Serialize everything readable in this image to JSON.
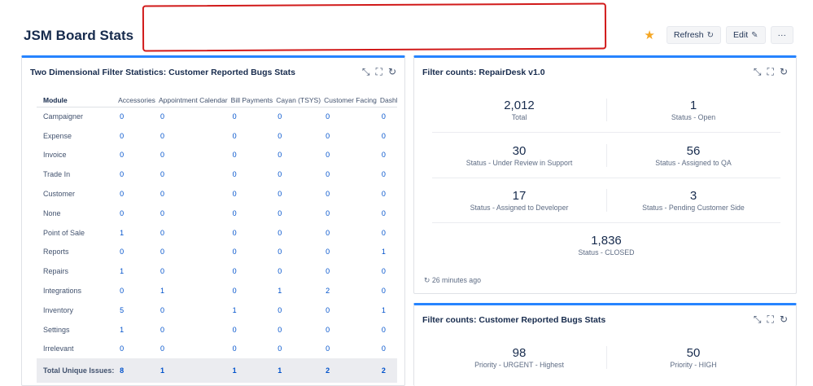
{
  "header": {
    "title": "JSM Board Stats",
    "refresh_label": "Refresh",
    "edit_label": "Edit",
    "more_label": "···"
  },
  "left_panel": {
    "title": "Two Dimensional Filter Statistics: Customer Reported Bugs Stats",
    "columns": [
      "Module",
      "Accessories",
      "Appointment Calendar",
      "Bill Payments",
      "Cayan (TSYS)",
      "Customer Facing",
      "Dashboa"
    ],
    "rows": [
      {
        "module": "Campaigner",
        "values": [
          "0",
          "0",
          "0",
          "0",
          "0",
          "0"
        ]
      },
      {
        "module": "Expense",
        "values": [
          "0",
          "0",
          "0",
          "0",
          "0",
          "0"
        ]
      },
      {
        "module": "Invoice",
        "values": [
          "0",
          "0",
          "0",
          "0",
          "0",
          "0"
        ]
      },
      {
        "module": "Trade In",
        "values": [
          "0",
          "0",
          "0",
          "0",
          "0",
          "0"
        ]
      },
      {
        "module": "Customer",
        "values": [
          "0",
          "0",
          "0",
          "0",
          "0",
          "0"
        ]
      },
      {
        "module": "None",
        "values": [
          "0",
          "0",
          "0",
          "0",
          "0",
          "0"
        ]
      },
      {
        "module": "Point of Sale",
        "values": [
          "1",
          "0",
          "0",
          "0",
          "0",
          "0"
        ]
      },
      {
        "module": "Reports",
        "values": [
          "0",
          "0",
          "0",
          "0",
          "0",
          "1"
        ]
      },
      {
        "module": "Repairs",
        "values": [
          "1",
          "0",
          "0",
          "0",
          "0",
          "0"
        ]
      },
      {
        "module": "Integrations",
        "values": [
          "0",
          "1",
          "0",
          "1",
          "2",
          "0"
        ]
      },
      {
        "module": "Inventory",
        "values": [
          "5",
          "0",
          "1",
          "0",
          "0",
          "1"
        ]
      },
      {
        "module": "Settings",
        "values": [
          "1",
          "0",
          "0",
          "0",
          "0",
          "0"
        ]
      },
      {
        "module": "Irrelevant",
        "values": [
          "0",
          "0",
          "0",
          "0",
          "0",
          "0"
        ]
      }
    ],
    "total": {
      "label": "Total Unique Issues:",
      "values": [
        "8",
        "1",
        "1",
        "1",
        "2",
        "2"
      ]
    }
  },
  "right_top": {
    "title": "Filter counts: RepairDesk v1.0",
    "stats": [
      {
        "value": "2,012",
        "label": "Total"
      },
      {
        "value": "1",
        "label": "Status - Open"
      },
      {
        "value": "30",
        "label": "Status - Under Review in Support"
      },
      {
        "value": "56",
        "label": "Status - Assigned to QA"
      },
      {
        "value": "17",
        "label": "Status - Assigned to Developer"
      },
      {
        "value": "3",
        "label": "Status - Pending Customer Side"
      },
      {
        "value": "1,836",
        "label": "Status - CLOSED"
      }
    ],
    "updated": "26 minutes ago"
  },
  "right_bottom": {
    "title": "Filter counts: Customer Reported Bugs Stats",
    "stats": [
      {
        "value": "98",
        "label": "Priority - URGENT - Highest"
      },
      {
        "value": "50",
        "label": "Priority - HIGH"
      }
    ]
  },
  "colors": {
    "accent": "#2684ff",
    "link": "#0052cc",
    "star": "#f5a623",
    "redaction": "#d11a1a"
  }
}
